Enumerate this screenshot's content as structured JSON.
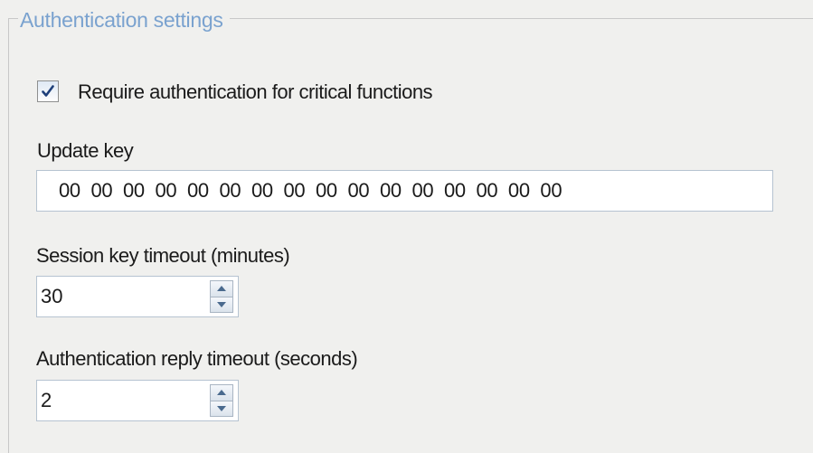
{
  "group": {
    "title": "Authentication settings"
  },
  "require_auth": {
    "label": "Require authentication for critical functions",
    "checked": true
  },
  "update_key": {
    "label": "Update key",
    "value": "00  00  00  00  00  00  00  00  00  00  00  00  00  00  00  00"
  },
  "session_timeout": {
    "label": "Session key timeout (minutes)",
    "value": "30"
  },
  "reply_timeout": {
    "label": "Authentication reply timeout (seconds)",
    "value": "2"
  },
  "icons": {
    "check": "check-icon",
    "spin_up": "arrow-up-icon",
    "spin_down": "arrow-down-icon"
  },
  "colors": {
    "group_title": "#7aa2cf",
    "checkmark": "#1e3f7a",
    "field_border": "#b6c3d1"
  }
}
